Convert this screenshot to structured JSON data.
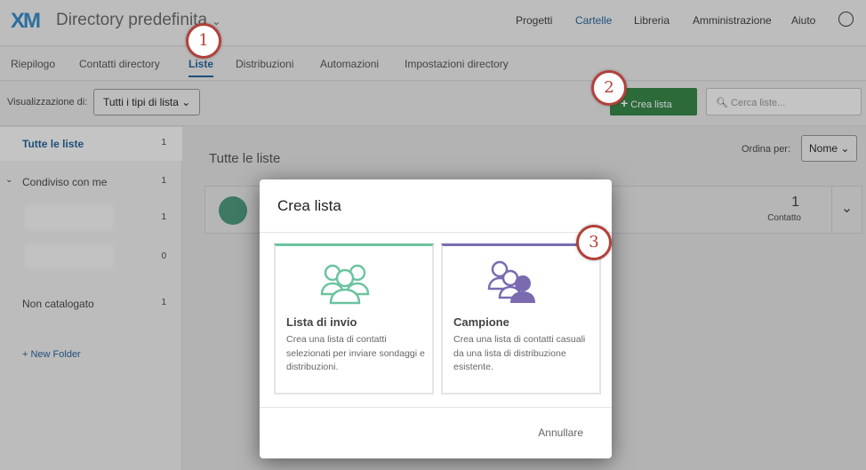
{
  "header": {
    "logo": "XM",
    "directory_title": "Directory predefinita",
    "nav": [
      "Progetti",
      "Cartelle",
      "Libreria",
      "Amministrazione",
      "Aiuto"
    ]
  },
  "tabs": [
    "Riepilogo",
    "Contatti directory",
    "Liste",
    "Distribuzioni",
    "Automazioni",
    "Impostazioni directory"
  ],
  "toolbar": {
    "view_label": "Visualizzazione di:",
    "view_value": "Tutti i tipi di lista",
    "create_label": "Crea lista",
    "search_placeholder": "Cerca liste..."
  },
  "sidebar": {
    "all": {
      "label": "Tutte le liste",
      "count": "1"
    },
    "shared": {
      "label": "Condiviso con me",
      "count": "1"
    },
    "hidden1_count": "1",
    "hidden2_count": "0",
    "uncat": {
      "label": "Non catalogato",
      "count": "1"
    },
    "new_folder": "+ New Folder"
  },
  "main": {
    "title": "Tutte le liste",
    "sort_label": "Ordina per:",
    "sort_value": "Nome",
    "list_count": "1",
    "list_count_label": "Contatto"
  },
  "modal": {
    "title": "Crea lista",
    "cards": [
      {
        "title": "Lista di invio",
        "desc": "Crea una lista di contatti selezionati per inviare sondaggi e distribuzioni.",
        "color": "#6cc3a0"
      },
      {
        "title": "Campione",
        "desc": "Crea una lista di contatti casuali da una lista di distribuzione esistente.",
        "color": "#7a6ab0"
      }
    ],
    "cancel": "Annullare"
  },
  "callouts": [
    "1",
    "2",
    "3"
  ]
}
